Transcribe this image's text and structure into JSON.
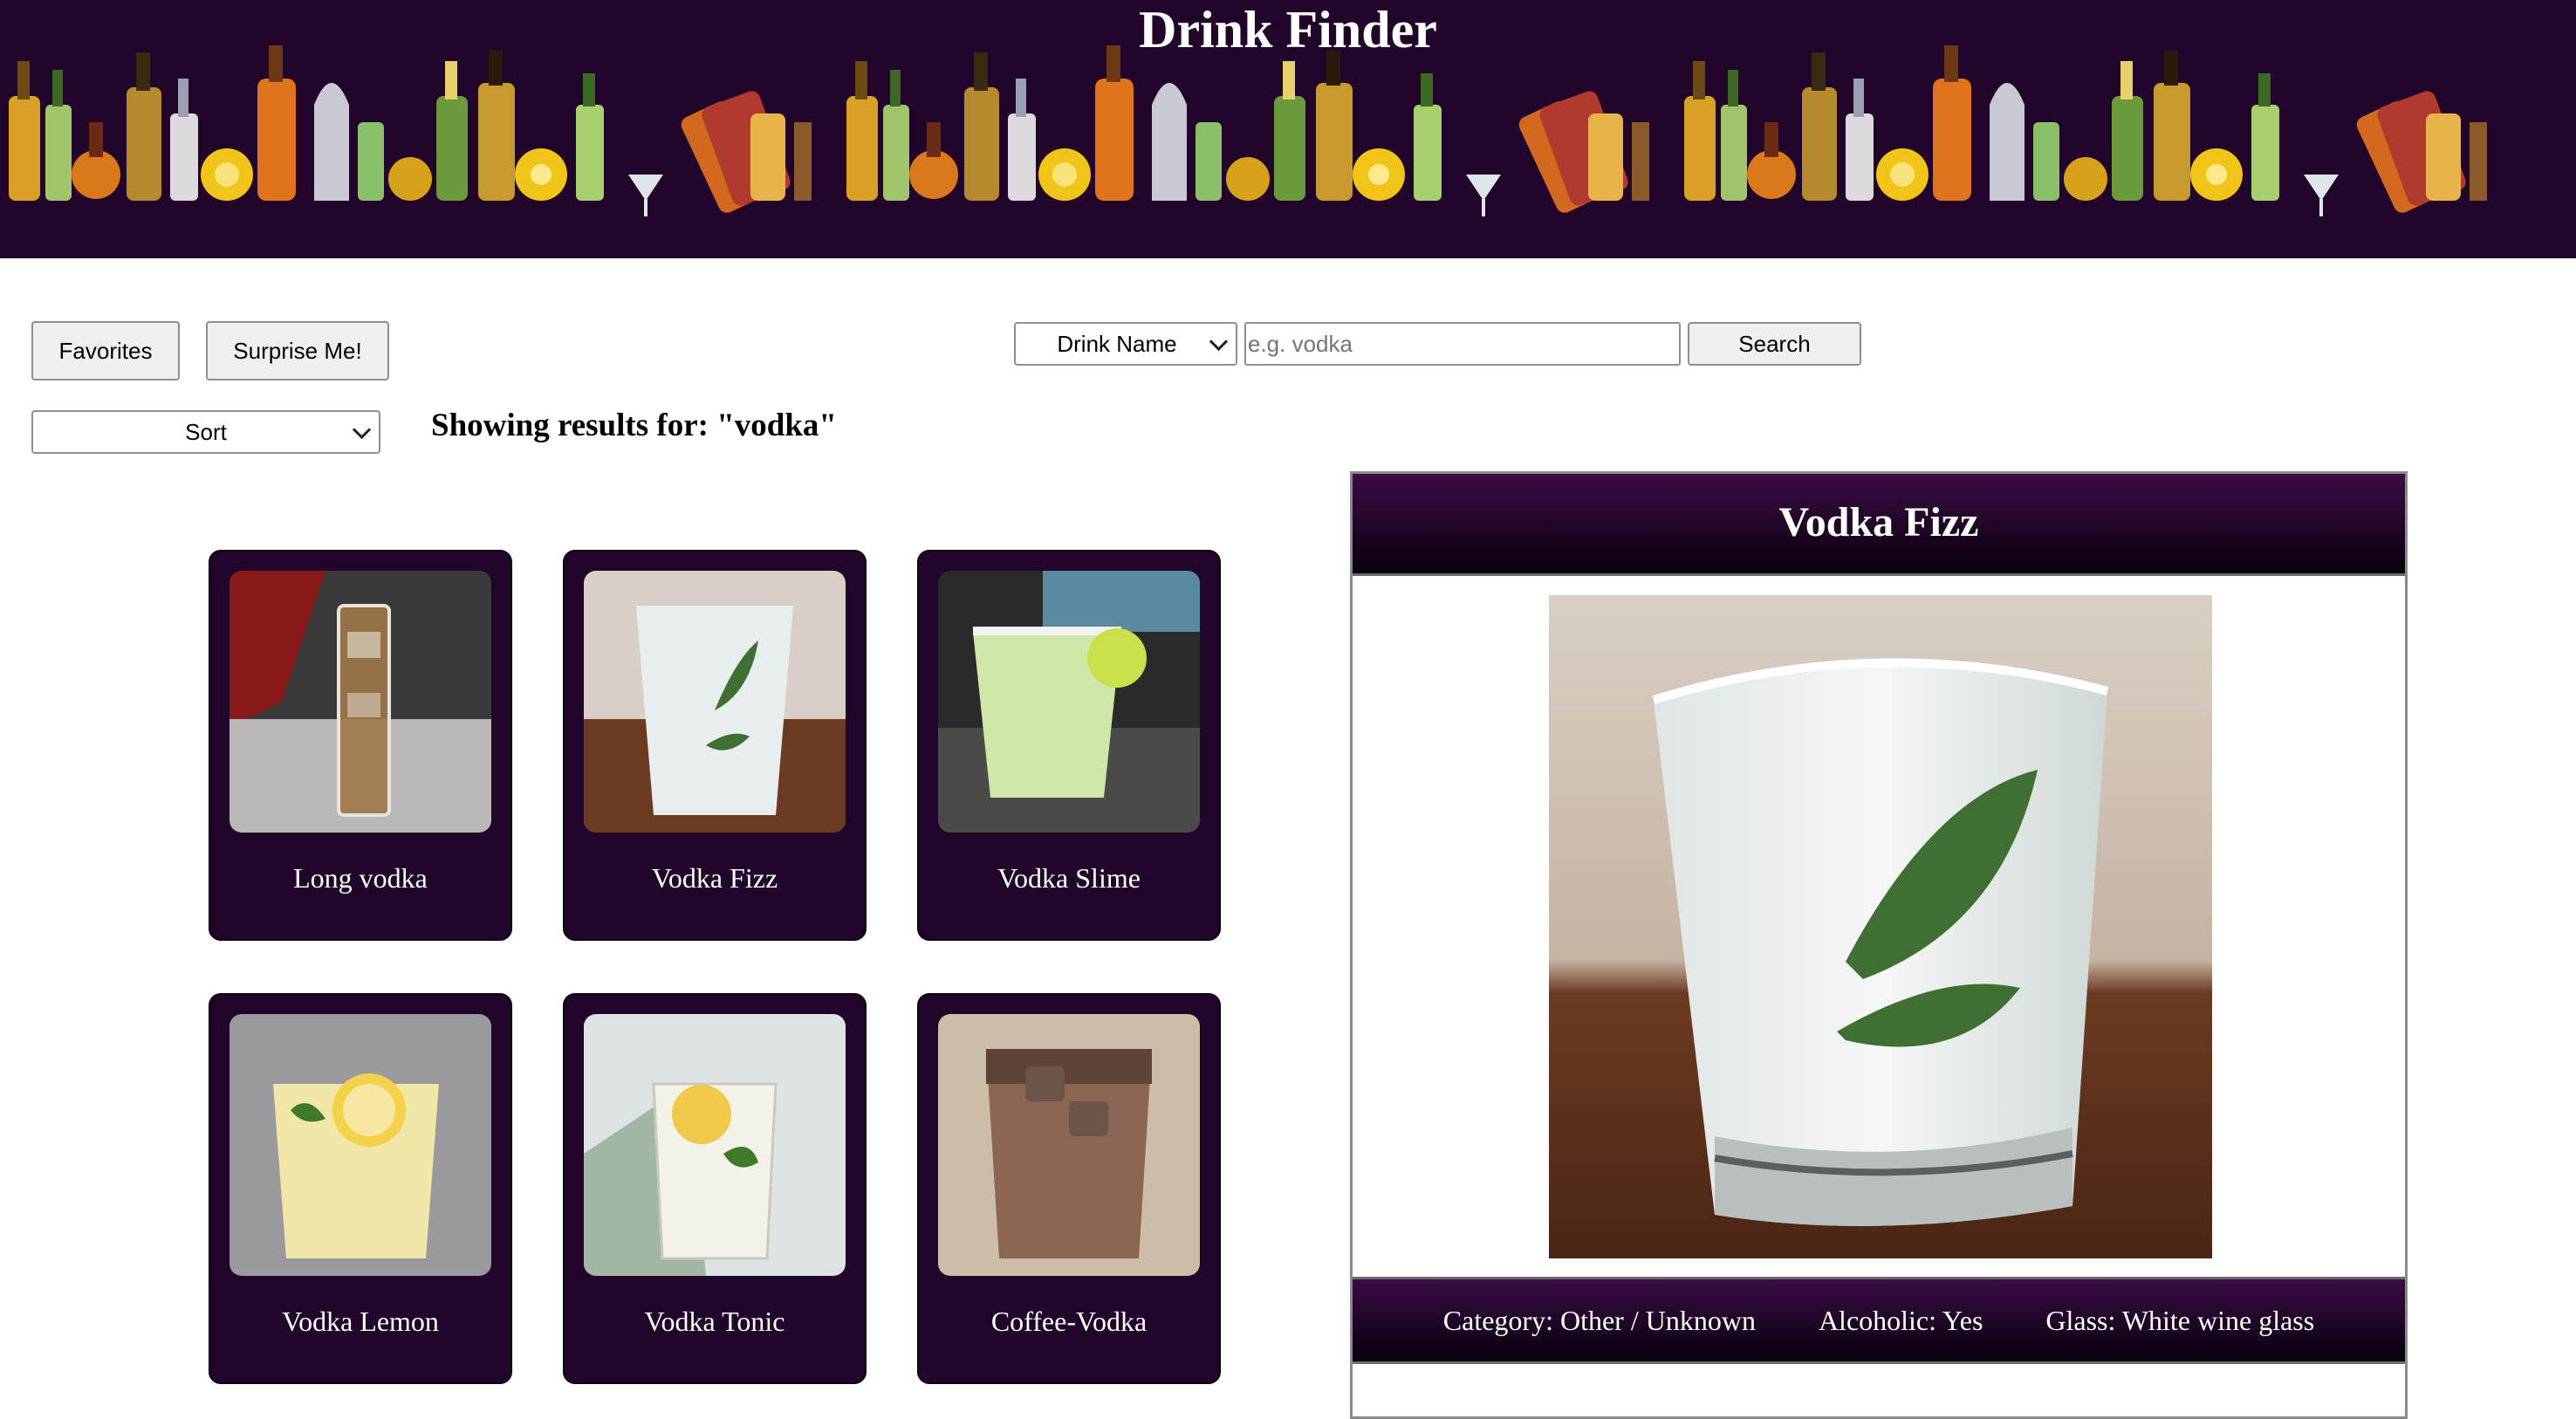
{
  "app": {
    "title": "Drink Finder"
  },
  "toolbar": {
    "favorites_label": "Favorites",
    "surprise_label": "Surprise Me!",
    "search_type": "Drink Name",
    "search_placeholder": "e.g. vodka",
    "search_value": "",
    "search_label": "Search",
    "sort_label": "Sort"
  },
  "results": {
    "label": "Showing results for:",
    "query": "\"vodka\""
  },
  "drinks": [
    {
      "name": "Long vodka"
    },
    {
      "name": "Vodka Fizz"
    },
    {
      "name": "Vodka Slime"
    },
    {
      "name": "Vodka Lemon"
    },
    {
      "name": "Vodka Tonic"
    },
    {
      "name": "Coffee-Vodka"
    }
  ],
  "detail": {
    "title": "Vodka Fizz",
    "category": "Category: Other / Unknown",
    "alcoholic": "Alcoholic: Yes",
    "glass": "Glass: White wine glass"
  },
  "colors": {
    "brand": "#22052b",
    "button_bg": "#efefef"
  }
}
